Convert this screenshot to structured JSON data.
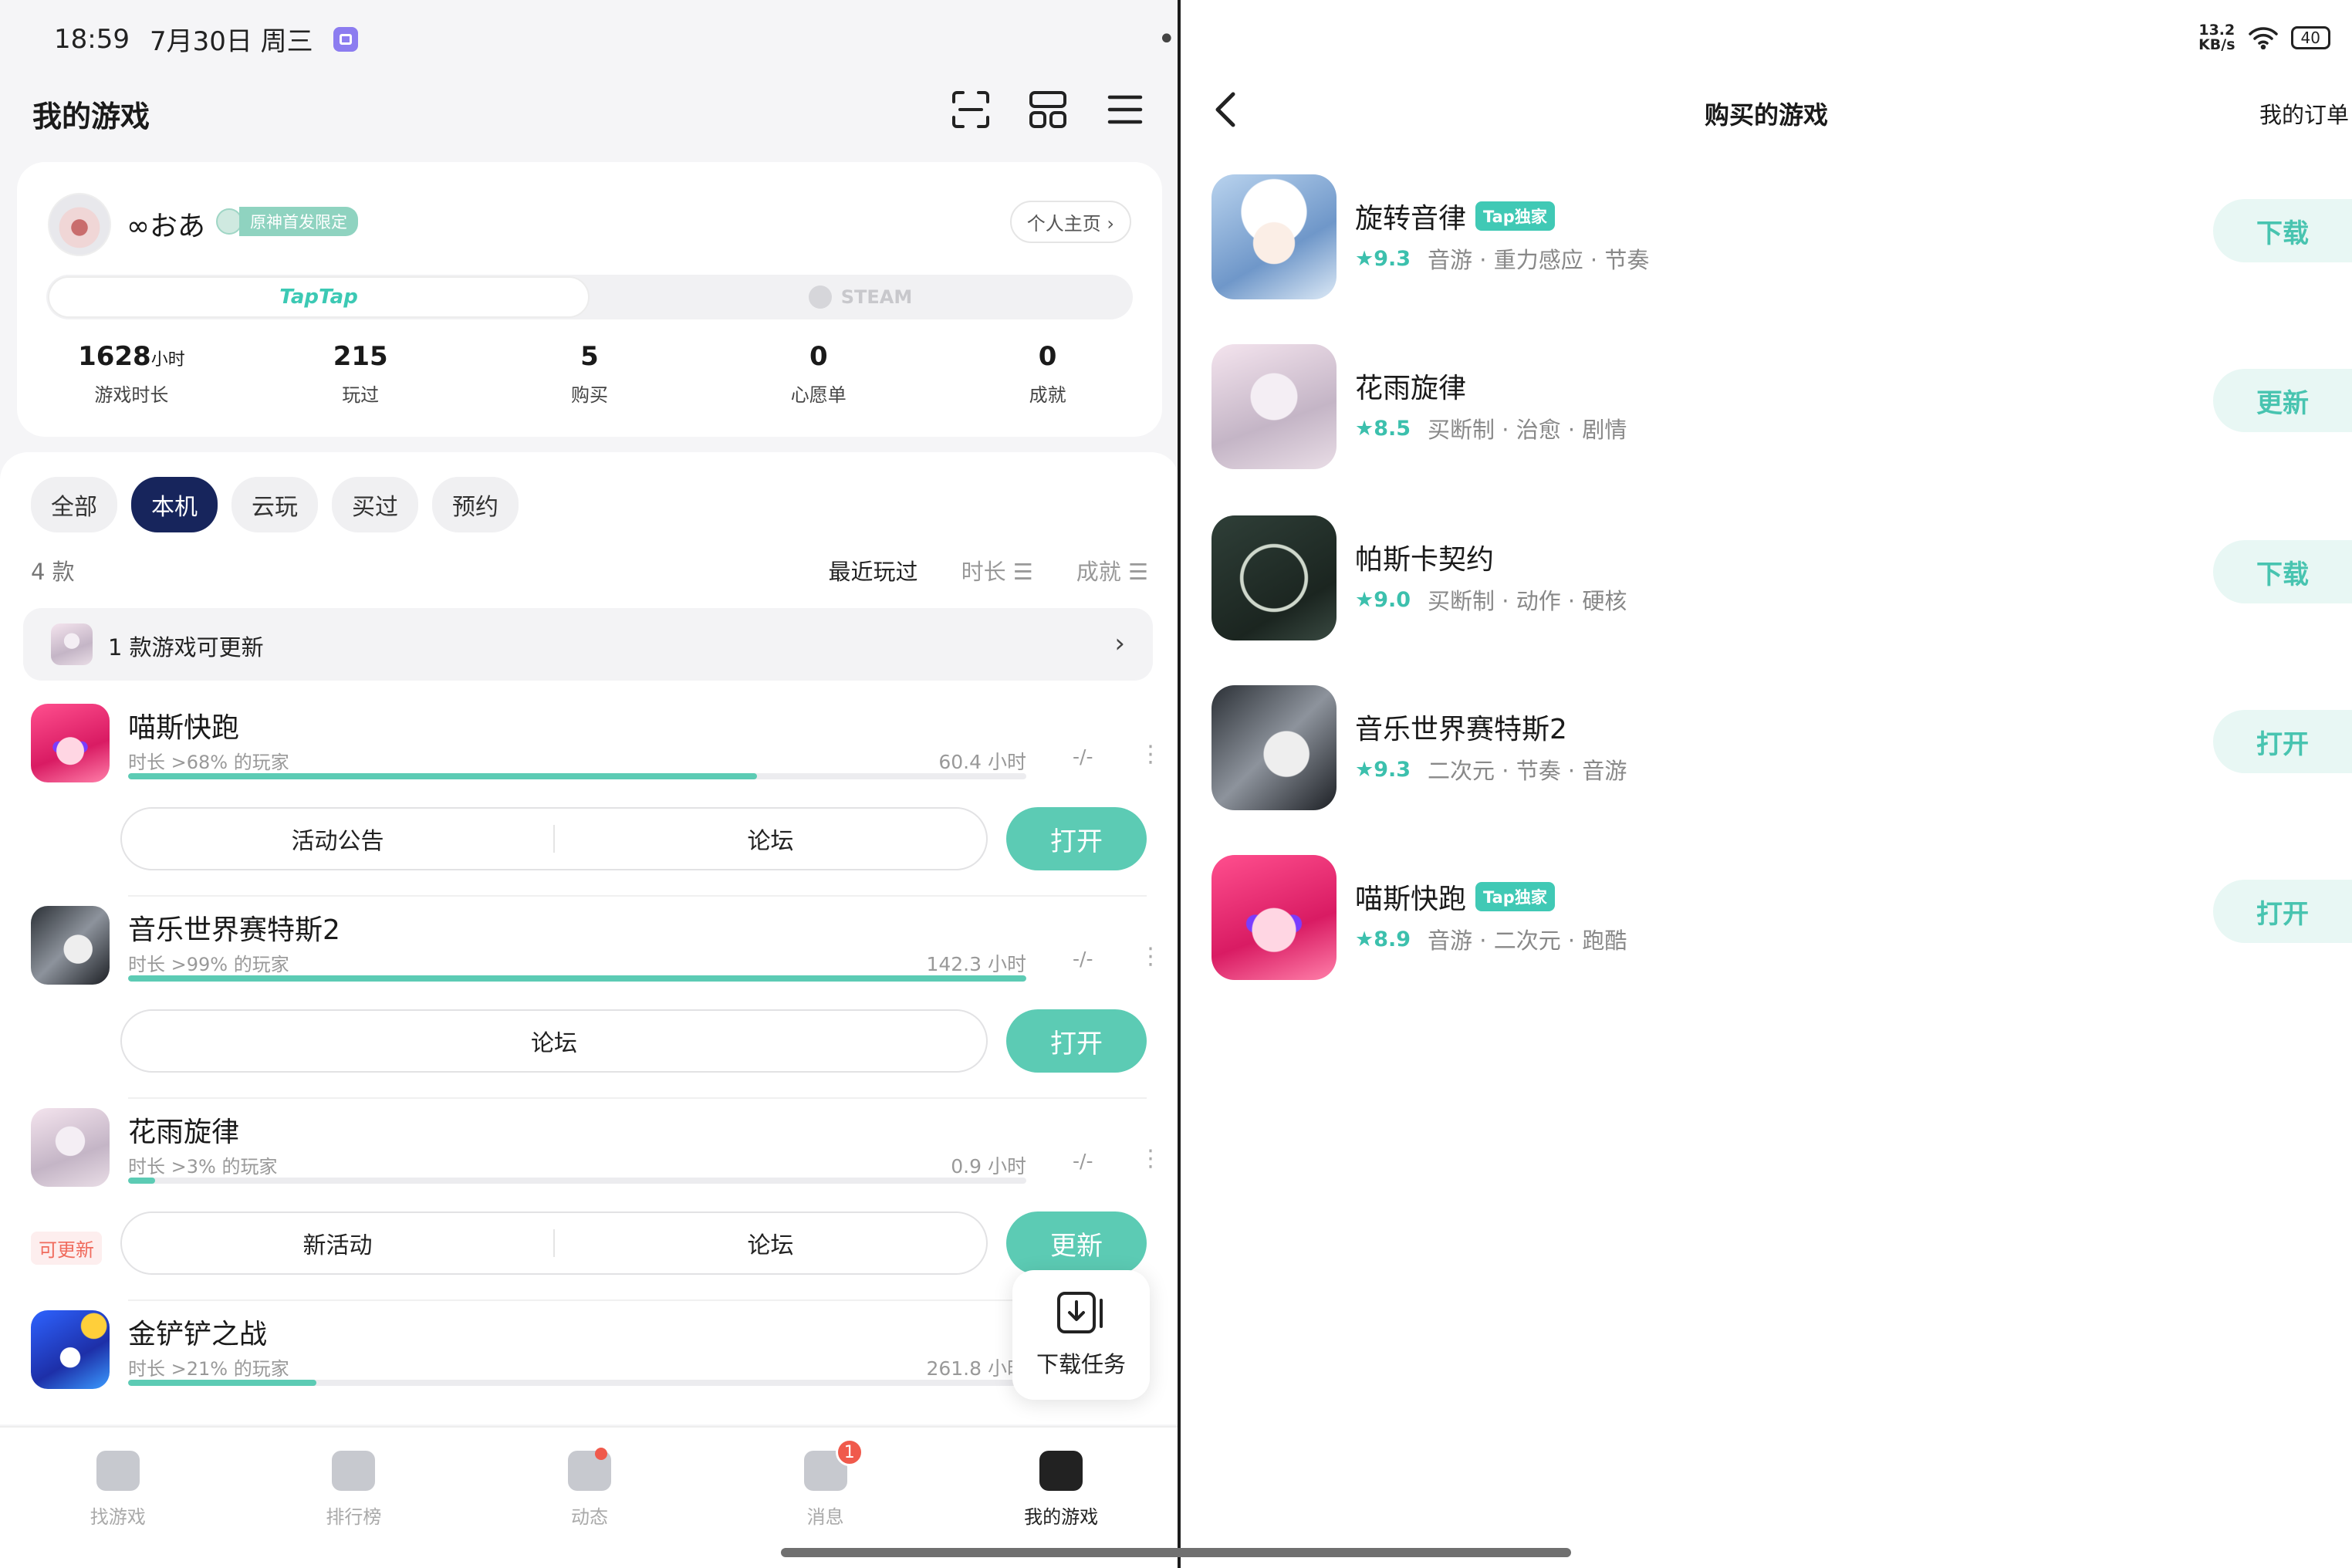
{
  "status": {
    "time": "18:59",
    "date": "7月30日 周三",
    "net_speed_top": "13.2",
    "net_speed_unit": "KB/s",
    "battery": "40"
  },
  "left": {
    "title": "我的游戏",
    "profile": {
      "name": "∞おあ",
      "badge": "原神首发限定",
      "homepage_btn": "个人主页 ›",
      "platform_taptap": "TapTap",
      "platform_steam": "STEAM",
      "stats": [
        {
          "num": "1628",
          "unit": "小时",
          "label": "游戏时长"
        },
        {
          "num": "215",
          "unit": "",
          "label": "玩过"
        },
        {
          "num": "5",
          "unit": "",
          "label": "购买"
        },
        {
          "num": "0",
          "unit": "",
          "label": "心愿单"
        },
        {
          "num": "0",
          "unit": "",
          "label": "成就"
        }
      ]
    },
    "filters": [
      "全部",
      "本机",
      "云玩",
      "买过",
      "预约"
    ],
    "active_filter": "本机",
    "count": "4 款",
    "sort": {
      "recent": "最近玩过",
      "duration": "时长 ☰",
      "achievement": "成就 ☰"
    },
    "update_banner": "1 款游戏可更新",
    "games": [
      {
        "name": "喵斯快跑",
        "sub": "时长 >68% 的玩家",
        "hours": "60.4 小时",
        "dash": "-/-",
        "progress": 0.7,
        "actions": [
          "活动公告",
          "论坛"
        ],
        "btn": "打开",
        "update": ""
      },
      {
        "name": "音乐世界赛特斯2",
        "sub": "时长 >99% 的玩家",
        "hours": "142.3 小时",
        "dash": "-/-",
        "progress": 1.0,
        "actions": [
          "论坛"
        ],
        "btn": "打开",
        "update": ""
      },
      {
        "name": "花雨旋律",
        "sub": "时长 >3% 的玩家",
        "hours": "0.9 小时",
        "dash": "-/-",
        "progress": 0.03,
        "actions": [
          "新活动",
          "论坛"
        ],
        "btn": "更新",
        "update": "可更新"
      },
      {
        "name": "金铲铲之战",
        "sub": "时长 >21% 的玩家",
        "hours": "261.8 小时",
        "dash": "",
        "progress": 0.21,
        "actions": [],
        "btn": "",
        "update": ""
      }
    ],
    "download_task": "下载任务",
    "nav": [
      {
        "label": "找游戏"
      },
      {
        "label": "排行榜"
      },
      {
        "label": "动态"
      },
      {
        "label": "消息",
        "badge": "1"
      },
      {
        "label": "我的游戏"
      }
    ]
  },
  "right": {
    "title": "购买的游戏",
    "orders": "我的订单",
    "games": [
      {
        "name": "旋转音律",
        "tap": "Tap独家",
        "rating": "★9.3",
        "tags": "音游 · 重力感应 · 节奏",
        "btn": "下载"
      },
      {
        "name": "花雨旋律",
        "tap": "",
        "rating": "★8.5",
        "tags": "买断制 · 治愈 · 剧情",
        "btn": "更新"
      },
      {
        "name": "帕斯卡契约",
        "tap": "",
        "rating": "★9.0",
        "tags": "买断制 · 动作 · 硬核",
        "btn": "下载"
      },
      {
        "name": "音乐世界赛特斯2",
        "tap": "",
        "rating": "★9.3",
        "tags": "二次元 · 节奏 · 音游",
        "btn": "打开"
      },
      {
        "name": "喵斯快跑",
        "tap": "Tap独家",
        "rating": "★8.9",
        "tags": "音游 · 二次元 · 跑酷",
        "btn": "打开"
      }
    ]
  }
}
